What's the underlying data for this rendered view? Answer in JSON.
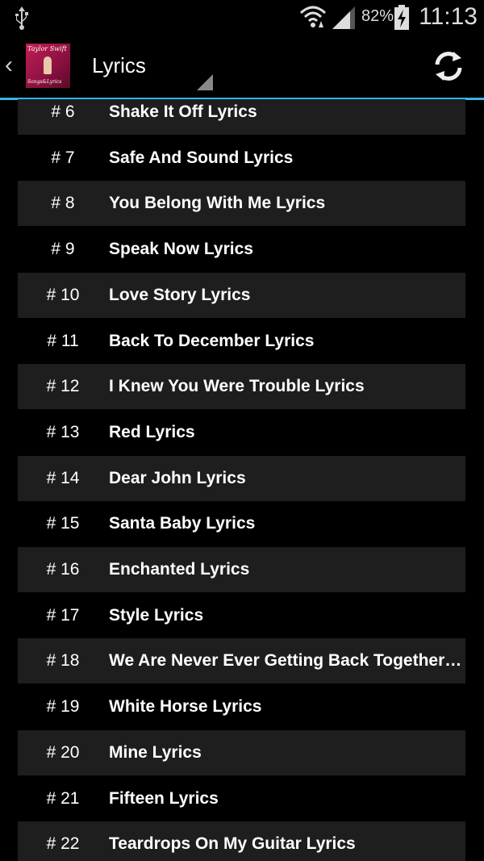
{
  "status": {
    "battery": "82%",
    "time": "11:13",
    "icons": [
      "usb-icon",
      "wifi-icon",
      "signal-icon",
      "battery-charging-icon"
    ]
  },
  "action_bar": {
    "title": "Lyrics",
    "logo_title": "Taylor Swift",
    "logo_subtitle": "Songs&Lyrics",
    "refresh_icon": "refresh-icon",
    "accent_color": "#33b5e5"
  },
  "songs": [
    {
      "num": "# 6",
      "title": "Shake It Off Lyrics"
    },
    {
      "num": "# 7",
      "title": "Safe And Sound Lyrics"
    },
    {
      "num": "# 8",
      "title": "You Belong With Me Lyrics"
    },
    {
      "num": "# 9",
      "title": "Speak Now Lyrics"
    },
    {
      "num": "# 10",
      "title": "Love Story Lyrics"
    },
    {
      "num": "# 11",
      "title": "Back To December Lyrics"
    },
    {
      "num": "# 12",
      "title": "I Knew You Were Trouble Lyrics"
    },
    {
      "num": "# 13",
      "title": "Red Lyrics"
    },
    {
      "num": "# 14",
      "title": "Dear John Lyrics"
    },
    {
      "num": "# 15",
      "title": "Santa Baby Lyrics"
    },
    {
      "num": "# 16",
      "title": "Enchanted Lyrics"
    },
    {
      "num": "# 17",
      "title": "Style Lyrics"
    },
    {
      "num": "# 18",
      "title": "We Are Never Ever Getting Back Together Lyrics"
    },
    {
      "num": "# 19",
      "title": "White Horse Lyrics"
    },
    {
      "num": "# 20",
      "title": "Mine Lyrics"
    },
    {
      "num": "# 21",
      "title": "Fifteen Lyrics"
    },
    {
      "num": "# 22",
      "title": "Teardrops On My Guitar Lyrics"
    }
  ]
}
